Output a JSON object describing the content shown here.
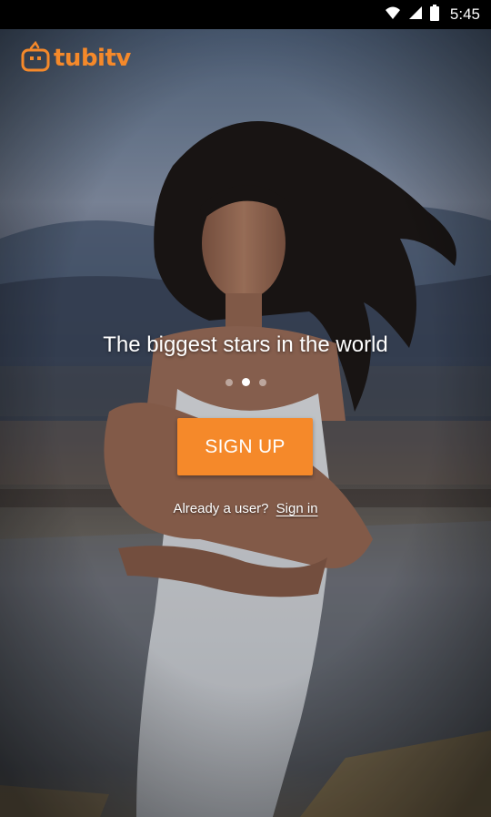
{
  "status_bar": {
    "time": "5:45",
    "icons": [
      "wifi-icon",
      "signal-icon",
      "battery-icon"
    ]
  },
  "brand": {
    "logo_text": "tubitv",
    "accent_color": "#f5892a"
  },
  "onboarding": {
    "headline": "The biggest stars in the world",
    "pager": {
      "total": 3,
      "active_index": 1
    },
    "signup_label": "SIGN UP",
    "already_user_text": "Already a user?",
    "signin_label": "Sign in"
  },
  "colors": {
    "button_bg": "#f5892a",
    "text": "#ffffff",
    "status_bar_bg": "#000000"
  }
}
